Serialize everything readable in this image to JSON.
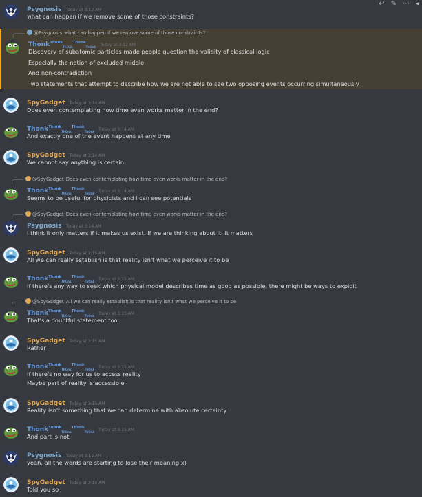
{
  "toolbar": {
    "reply_icon": "reply-icon",
    "edit_icon": "edit-icon",
    "more_icon": "more-icon",
    "reaction_icon": "react-icon"
  },
  "users": {
    "psygnosis": {
      "name": "Psygnosis",
      "color": "#7ea7c9",
      "avatar": "owl-avatar"
    },
    "thonk": {
      "name": "Thonk",
      "sup": "Thonk",
      "sub": "ThOnk",
      "color": "#6a9bd8",
      "avatar": "pepe-frog-avatar"
    },
    "spygadget": {
      "name": "SpyGadget",
      "color": "#e0a95b",
      "avatar": "spy-circle-avatar"
    }
  },
  "messages": [
    {
      "id": "m1",
      "user": "psygnosis",
      "name": "Psygnosis",
      "timestamp": "Today at 3:12 AM",
      "lines": [
        "what can happen if we remove some of those constraints?"
      ]
    },
    {
      "id": "m2",
      "user": "thonk",
      "name": "Thonk",
      "name_sup": "Thonk",
      "name_sub": "ThOnk",
      "name_sup2": "Thonk",
      "name_sub2": "ThOnk",
      "timestamp": "Today at 3:12 AM",
      "highlighted": true,
      "reply": {
        "user": "psygnosis",
        "name": "@Psygnosis",
        "text": "what can happen if we remove some of those constraints?"
      },
      "lines": [
        "Discovery of subatomic particles made people question the validity of classical logic",
        "Especially the notion of excluded middle",
        "And non-contradiction",
        "Two statements that attempt to describe how we are not able to see two opposing events occurring simultaneously"
      ]
    },
    {
      "id": "m3",
      "user": "spygadget",
      "name": "SpyGadget",
      "timestamp": "Today at 3:14 AM",
      "lines": [
        "Does even contemplating how time even works matter in the end?"
      ]
    },
    {
      "id": "m4",
      "user": "thonk",
      "name": "Thonk",
      "name_sup": "Thonk",
      "name_sub": "ThOnk",
      "name_sup2": "Thonk",
      "name_sub2": "ThOnk",
      "timestamp": "Today at 3:14 AM",
      "lines": [
        "And exactly one of the event happens at any time"
      ]
    },
    {
      "id": "m5",
      "user": "spygadget",
      "name": "SpyGadget",
      "timestamp": "Today at 3:14 AM",
      "lines": [
        "We cannot say anything is certain"
      ]
    },
    {
      "id": "m6",
      "user": "thonk",
      "name": "Thonk",
      "name_sup": "Thonk",
      "name_sub": "ThOnk",
      "name_sup2": "Thonk",
      "name_sub2": "ThOnk",
      "timestamp": "Today at 3:14 AM",
      "reply": {
        "user": "spygadget",
        "name": "@SpyGadget",
        "text": "Does even contemplating how time even works matter in the end?"
      },
      "lines": [
        "Seems to be useful for physicists and I can see potentials"
      ]
    },
    {
      "id": "m7",
      "user": "psygnosis",
      "name": "Psygnosis",
      "timestamp": "Today at 3:14 AM",
      "reply": {
        "user": "spygadget",
        "name": "@SpyGadget",
        "text": "Does even contemplating how time even works matter in the end?"
      },
      "lines": [
        "I think it only matters if it makes us exist. If we are thinking about it, it matters"
      ]
    },
    {
      "id": "m8",
      "user": "spygadget",
      "name": "SpyGadget",
      "timestamp": "Today at 3:15 AM",
      "lines": [
        "All we can really establish is that reality isn't what we perceive it to be"
      ]
    },
    {
      "id": "m9",
      "user": "thonk",
      "name": "Thonk",
      "name_sup": "Thonk",
      "name_sub": "ThOnk",
      "name_sup2": "Thonk",
      "name_sub2": "ThOnk",
      "timestamp": "Today at 3:15 AM",
      "lines": [
        "If there's any way to seek which physical model describes time as good as possible, there might be ways to exploit"
      ]
    },
    {
      "id": "m10",
      "user": "thonk",
      "name": "Thonk",
      "name_sup": "Thonk",
      "name_sub": "ThOnk",
      "name_sup2": "Thonk",
      "name_sub2": "ThOnk",
      "timestamp": "Today at 3:15 AM",
      "reply": {
        "user": "spygadget",
        "name": "@SpyGadget",
        "text": "All we can really establish is that reality isn't what we perceive it to be"
      },
      "lines": [
        "That's a doubtful statement too"
      ]
    },
    {
      "id": "m11",
      "user": "spygadget",
      "name": "SpyGadget",
      "timestamp": "Today at 3:15 AM",
      "lines": [
        "Rather"
      ]
    },
    {
      "id": "m12",
      "user": "thonk",
      "name": "Thonk",
      "name_sup": "Thonk",
      "name_sub": "ThOnk",
      "name_sup2": "Thonk",
      "name_sub2": "ThOnk",
      "timestamp": "Today at 3:15 AM",
      "lines": [
        "If there's no way for us to access reality",
        "Maybe part of reality is accessible"
      ]
    },
    {
      "id": "m13",
      "user": "spygadget",
      "name": "SpyGadget",
      "timestamp": "Today at 3:15 AM",
      "lines": [
        "Reality isn't something that we can determine with absolute certainty"
      ]
    },
    {
      "id": "m14",
      "user": "thonk",
      "name": "Thonk",
      "name_sup": "Thonk",
      "name_sub": "ThOnk",
      "name_sup2": "Thonk",
      "name_sub2": "ThOnk",
      "timestamp": "Today at 3:15 AM",
      "lines": [
        "And part is not."
      ]
    },
    {
      "id": "m15",
      "user": "psygnosis",
      "name": "Psygnosis",
      "timestamp": "Today at 3:16 AM",
      "lines": [
        "yeah, all the words are starting to lose their meaning x)"
      ]
    },
    {
      "id": "m16",
      "user": "spygadget",
      "name": "SpyGadget",
      "timestamp": "Today at 3:16 AM",
      "lines": [
        "Told you so"
      ]
    }
  ]
}
